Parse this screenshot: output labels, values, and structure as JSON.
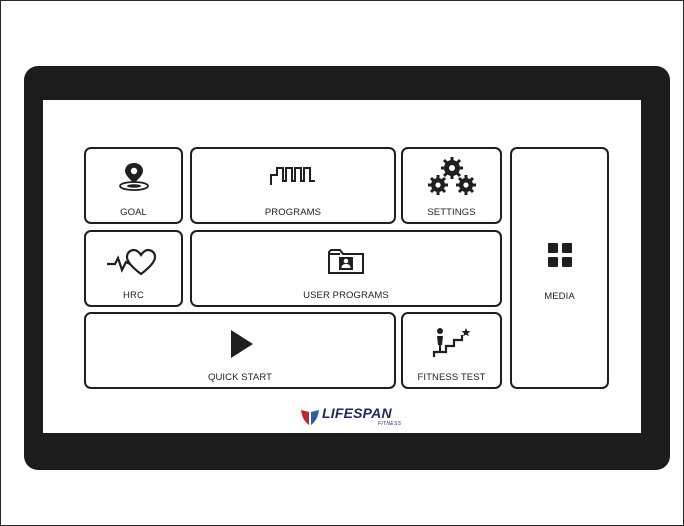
{
  "tiles": {
    "goal": "GOAL",
    "programs": "PROGRAMS",
    "settings": "SETTINGS",
    "media": "MEDIA",
    "hrc": "HRC",
    "user_programs": "USER PROGRAMS",
    "quick_start": "QUICK START",
    "fitness_test": "FITNESS TEST"
  },
  "brand": {
    "name": "LIFESPAN",
    "sub": "FITNESS",
    "colors": {
      "left": "#c0272d",
      "right": "#2a5ea8",
      "text": "#1f2a5c"
    }
  },
  "icons": {
    "goal": "location-pin-icon",
    "programs": "square-wave-icon",
    "settings": "gears-icon",
    "media": "grid-icon",
    "hrc": "heart-rate-icon",
    "user_programs": "user-folder-icon",
    "quick_start": "play-icon",
    "fitness_test": "stairs-climber-icon"
  }
}
